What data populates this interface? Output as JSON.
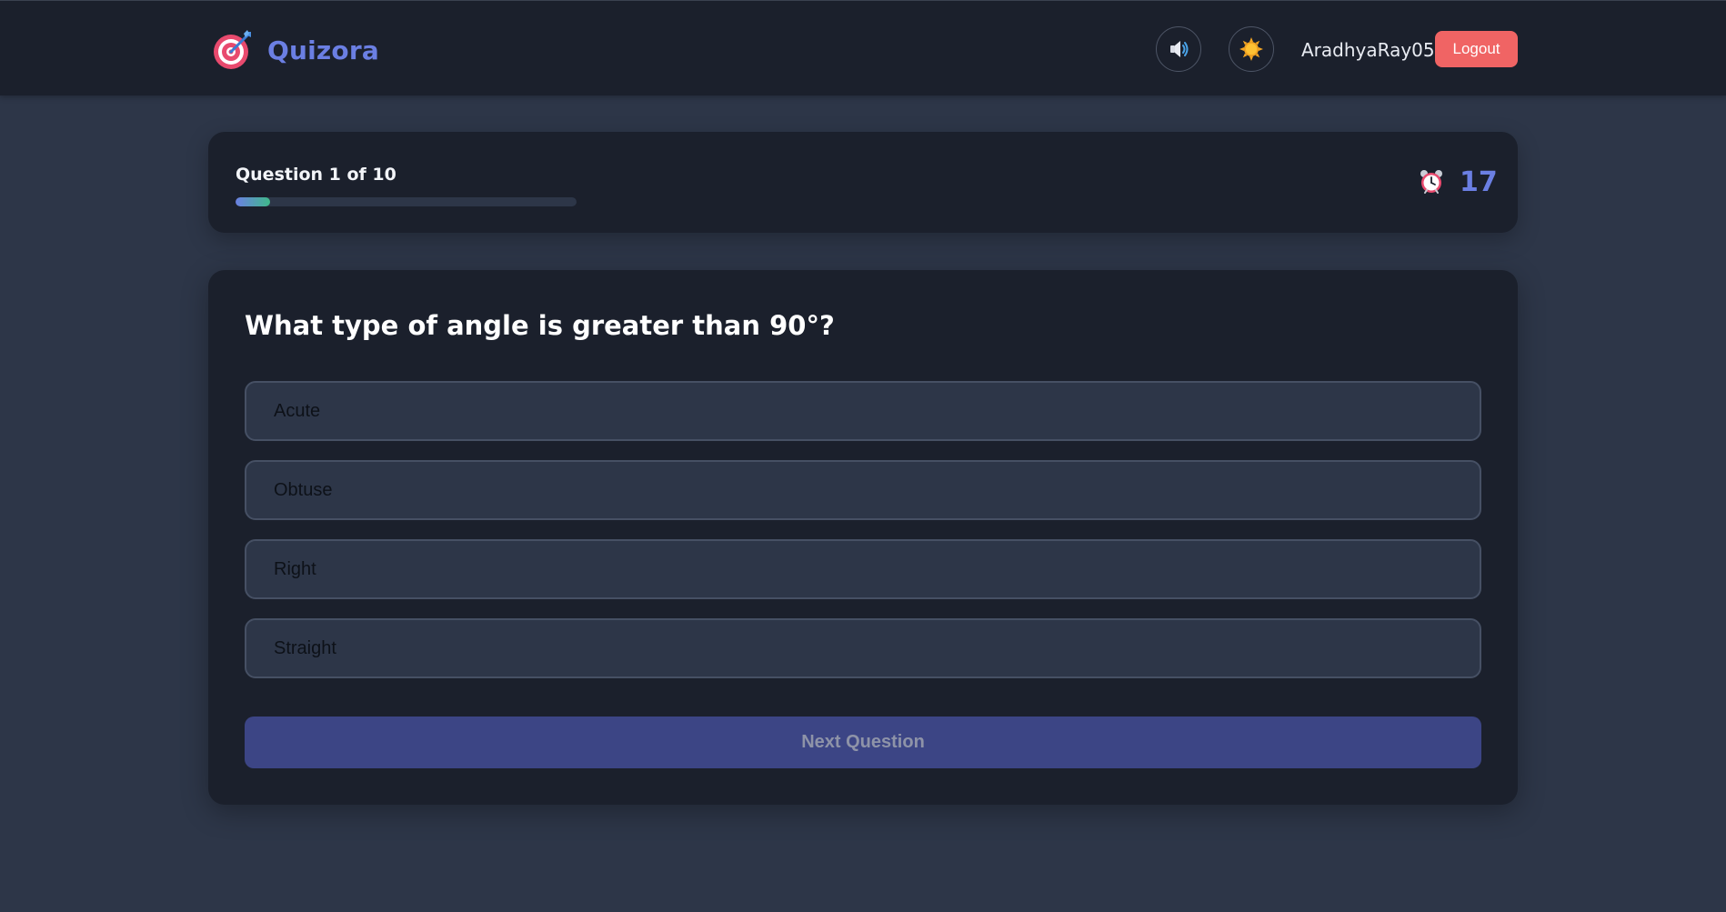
{
  "header": {
    "brand_name": "Quizora",
    "brand_icon": "dart-target-icon",
    "sound_icon": "speaker-icon",
    "theme_icon": "sun-icon",
    "username": "AradhyaRay05",
    "logout_label": "Logout"
  },
  "progress": {
    "counter_text": "Question 1 of 10",
    "fraction": 0.1,
    "timer_icon": "alarm-clock-icon",
    "timer_value": "17"
  },
  "question": {
    "text": "What type of angle is greater than 90°?",
    "options": [
      "Acute",
      "Obtuse",
      "Right",
      "Straight"
    ],
    "next_label": "Next Question"
  },
  "colors": {
    "background": "#2d3648",
    "surface": "#1b202c",
    "accent": "#6b7fe3",
    "danger": "#f06464",
    "progress_end": "#3fb98a"
  }
}
